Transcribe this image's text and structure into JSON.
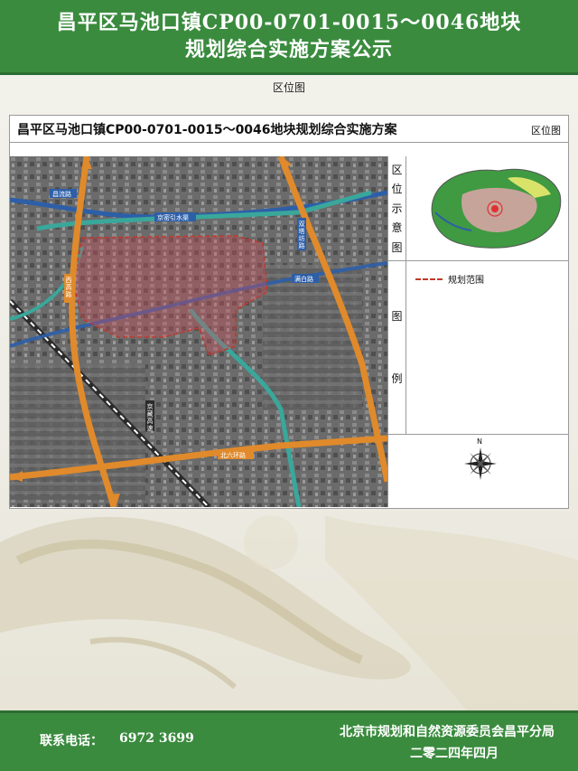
{
  "banner": {
    "line1": "昌平区马池口镇CP00-0701-0015～0046地块",
    "line2": "规划综合实施方案公示"
  },
  "section_label": "区位图",
  "panel": {
    "title": "昌平区马池口镇CP00-0701-0015～0046地块规划综合实施方案",
    "tag": "区位图"
  },
  "map": {
    "road_labels": [
      "昌流路",
      "京密引水渠",
      "双塔坊路",
      "西高路",
      "满白路",
      "北六环路",
      "京藏高速"
    ]
  },
  "sidebar": {
    "location_heading": [
      "区",
      "位",
      "示",
      "意",
      "图"
    ],
    "legend_heading": [
      "图",
      "例"
    ],
    "legend_items": [
      {
        "label": "规划范围",
        "color": "#c0392b"
      }
    ],
    "north_label": "N"
  },
  "footer": {
    "contact_label": "联系电话：",
    "contact_number": "6972 3699",
    "issuer": "北京市规划和自然资源委员会昌平分局",
    "date": "二零二四年四月"
  },
  "colors": {
    "banner": "#3a8b3e",
    "road": "#e08a2b",
    "canal": "#2d5fa8",
    "boundary": "#c0392b"
  }
}
